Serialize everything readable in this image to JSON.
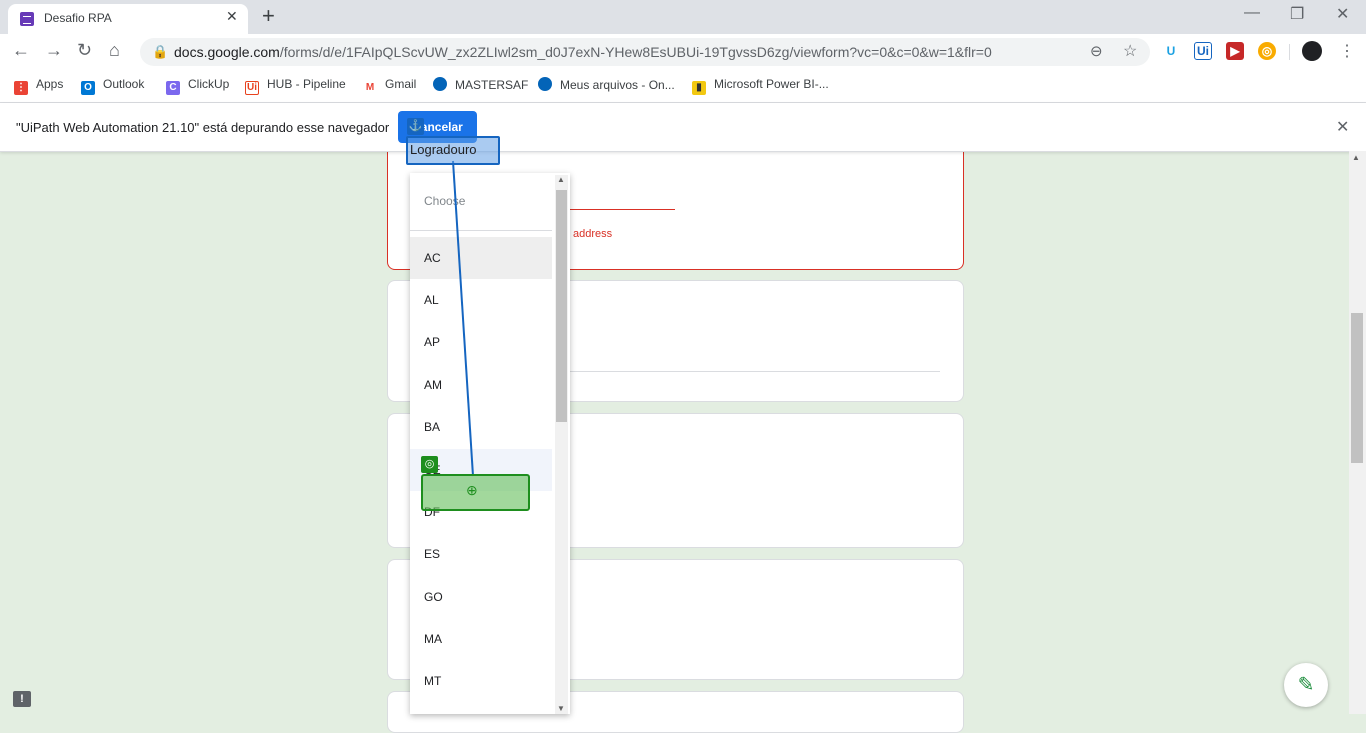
{
  "browser": {
    "tab_title": "Desafio RPA",
    "url_host": "docs.google.com",
    "url_path": "/forms/d/e/1FAIpQLScvUW_zx2ZLIwl2sm_d0J7exN-YHew8EsUBUi-19TgvssD6zg/viewform?vc=0&c=0&w=1&flr=0",
    "bookmarks": [
      "Apps",
      "Outlook",
      "ClickUp",
      "HUB - Pipeline",
      "Gmail",
      "MASTERSAF",
      "Meus arquivos - On...",
      "Microsoft Power BI-..."
    ]
  },
  "debug_bar": {
    "message": "\"UiPath Web Automation 21.10\" está depurando esse navegador",
    "cancel_label": "Cancelar"
  },
  "form": {
    "error_text": "address"
  },
  "dropdown": {
    "placeholder": "Choose",
    "options": [
      "AC",
      "AL",
      "AP",
      "AM",
      "BA",
      "CE",
      "DF",
      "ES",
      "GO",
      "MA",
      "MT"
    ],
    "hovered_index": 0,
    "highlighted_index": 5
  },
  "uipath": {
    "anchor_label": "Logradouro"
  },
  "colors": {
    "page_bg": "#e3eee1",
    "error": "#d93025",
    "anchor": "#1565c0",
    "target": "#1e8e1e",
    "accent": "#1a73e8"
  }
}
